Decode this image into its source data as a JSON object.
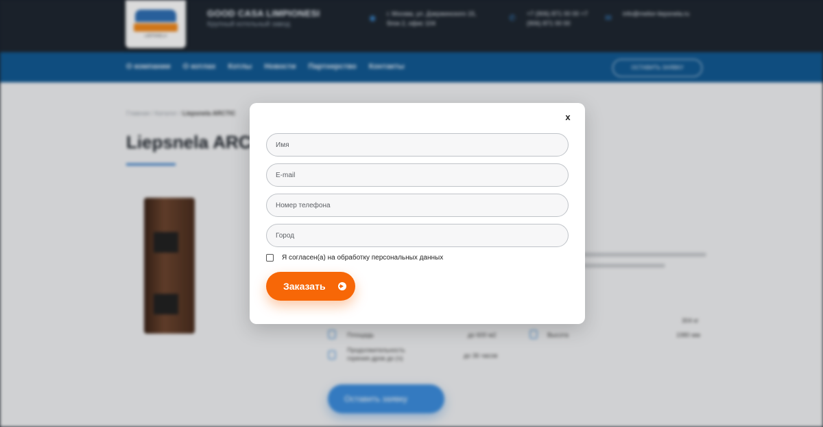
{
  "header": {
    "company_name": "GOOD CASA LIMPIONESI",
    "company_sub": "Крупный котельный завод",
    "logo_text": "LIEPSNELA",
    "address": "г. Москва, ул. Дзержинского 15, блок 2, офис 104",
    "phone": "+7 (906) 871 00 00 +7 (906) 871 00 00",
    "email": "info@melior-liepsnela.ru",
    "cta": "Оставить заявку"
  },
  "nav": {
    "items": [
      "О компании",
      "О котлах",
      "Котлы",
      "Новости",
      "Партнерство",
      "Контакты"
    ]
  },
  "page": {
    "breadcrumb_prefix": "Главная / Каталог / ",
    "breadcrumb_current": "Liepsnela ARCTIC",
    "title": "Liepsnela ARCTIC",
    "specs": [
      {
        "label": "Площадь",
        "value": "до 600 м2"
      },
      {
        "label": "Продолжительность горения дров до (ч)",
        "value": "до 36 часов"
      },
      {
        "label": "",
        "value": "304 кг"
      },
      {
        "label": "Высота",
        "value": "1980 мм"
      }
    ],
    "order_button": "Оставить заявку"
  },
  "modal": {
    "close_label": "x",
    "fields": {
      "name_placeholder": "Имя",
      "email_placeholder": "E-mail",
      "phone_placeholder": "Номер телефона",
      "city_placeholder": "Город"
    },
    "consent_label": "Я согласен(а) на обработку персональных данных",
    "submit_label": "Заказать"
  },
  "colors": {
    "header_bg": "#1f2731",
    "nav_bg": "#125a94",
    "accent_orange": "#f76707",
    "accent_blue": "#3d8fe0"
  },
  "icons": [
    "map-pin-icon",
    "phone-icon",
    "mail-icon",
    "arrow-right-icon",
    "area-icon",
    "clock-icon",
    "height-icon"
  ]
}
